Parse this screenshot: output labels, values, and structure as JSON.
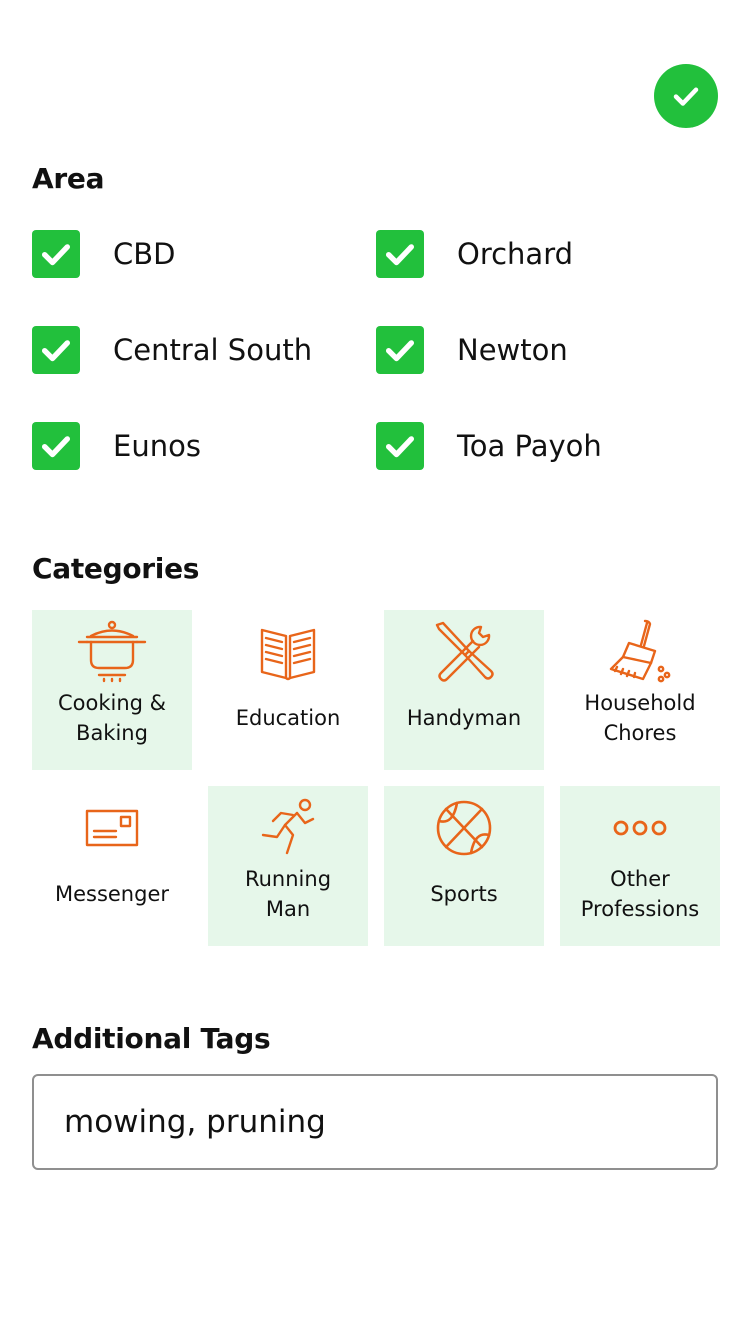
{
  "colors": {
    "accent_green": "#22c03c",
    "selected_tile_bg": "#e6f7ea",
    "icon_orange": "#e8651a"
  },
  "header": {
    "confirm_icon": "check-icon"
  },
  "area": {
    "title": "Area",
    "items": [
      {
        "label": "CBD",
        "checked": true
      },
      {
        "label": "Orchard",
        "checked": true
      },
      {
        "label": "Central South",
        "checked": true
      },
      {
        "label": "Newton",
        "checked": true
      },
      {
        "label": "Eunos",
        "checked": true
      },
      {
        "label": "Toa Payoh",
        "checked": true
      }
    ]
  },
  "categories": {
    "title": "Categories",
    "items": [
      {
        "label_line1": "Cooking &",
        "label_line2": "Baking",
        "icon": "cooking-pot-icon",
        "selected": true
      },
      {
        "label_line1": "Education",
        "label_line2": "",
        "icon": "book-icon",
        "selected": false
      },
      {
        "label_line1": "Handyman",
        "label_line2": "",
        "icon": "tools-icon",
        "selected": true
      },
      {
        "label_line1": "Household",
        "label_line2": "Chores",
        "icon": "broom-icon",
        "selected": false
      },
      {
        "label_line1": "Messenger",
        "label_line2": "",
        "icon": "envelope-icon",
        "selected": false
      },
      {
        "label_line1": "Running",
        "label_line2": "Man",
        "icon": "running-man-icon",
        "selected": true
      },
      {
        "label_line1": "Sports",
        "label_line2": "",
        "icon": "basketball-icon",
        "selected": true
      },
      {
        "label_line1": "Other",
        "label_line2": "Professions",
        "icon": "more-dots-icon",
        "selected": true
      }
    ]
  },
  "tags": {
    "title": "Additional Tags",
    "value": "mowing, pruning"
  }
}
